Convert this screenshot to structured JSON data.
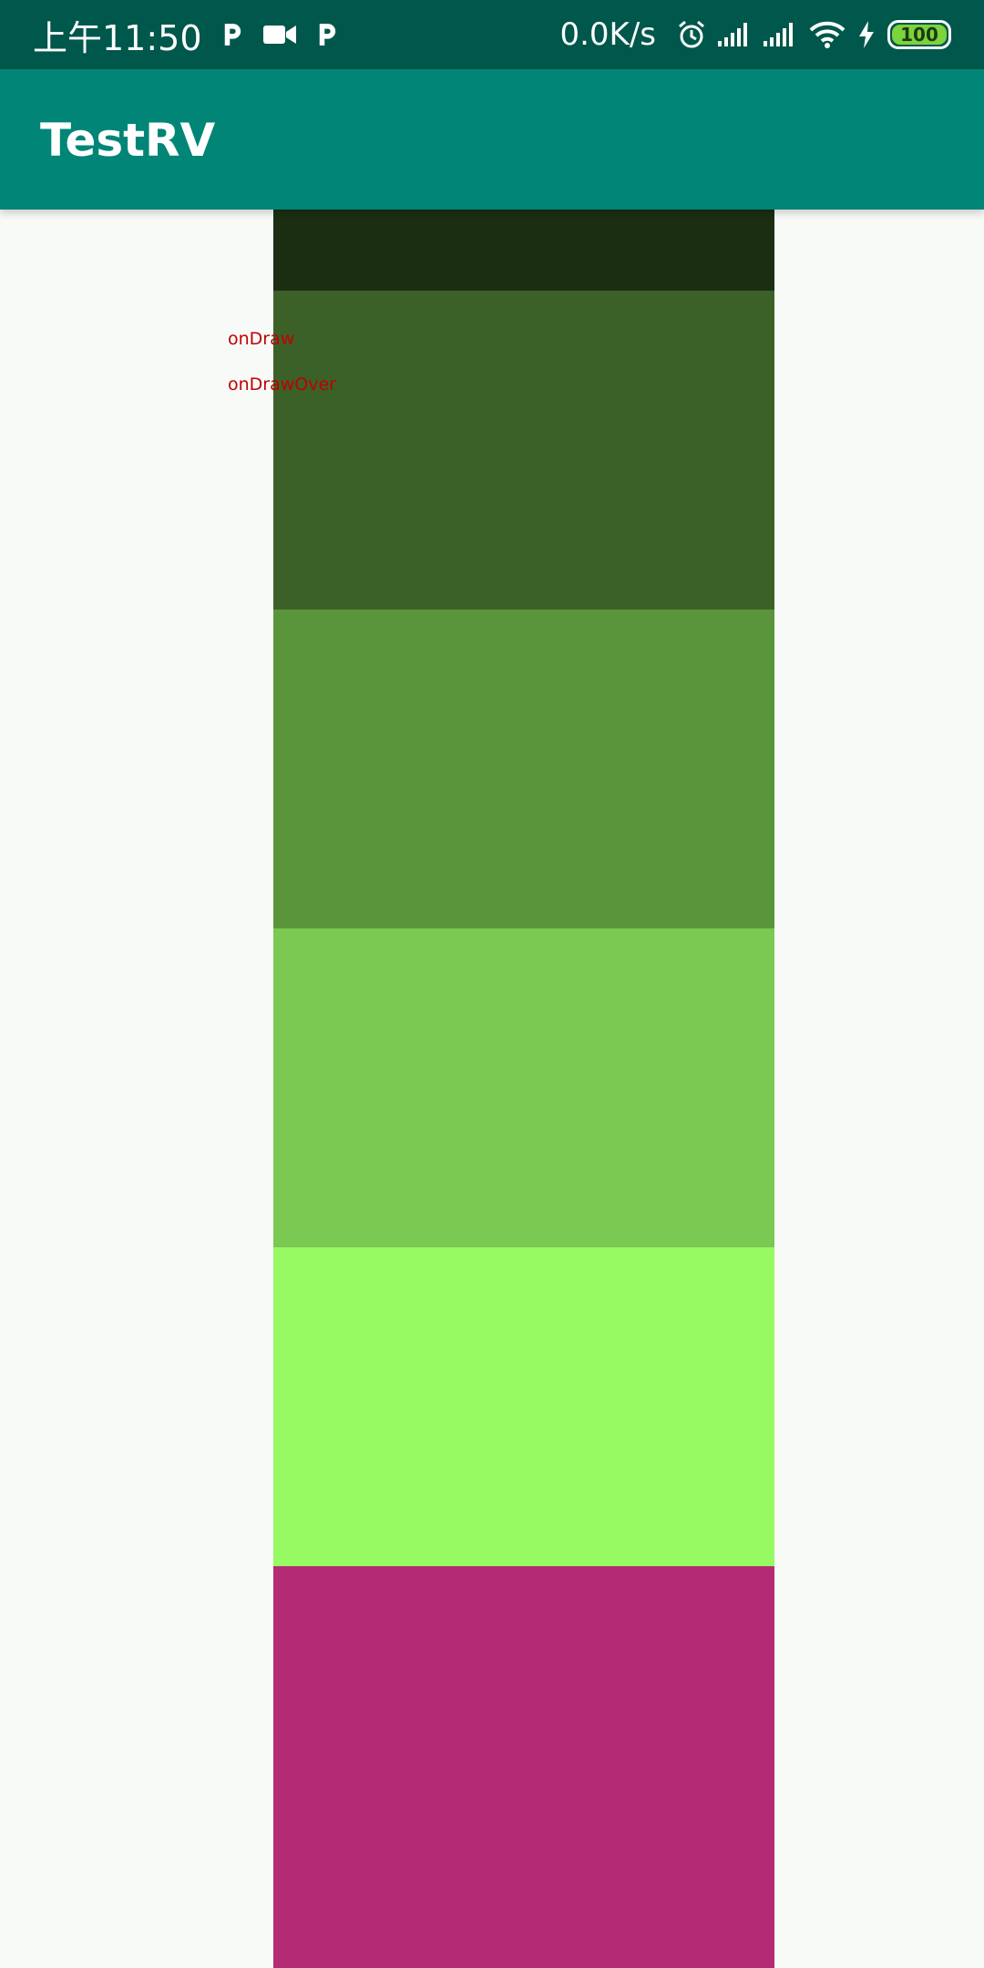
{
  "status_bar": {
    "time": "上午11:50",
    "left_icons": [
      "p-app-icon",
      "video-camera-icon",
      "p-app-icon"
    ],
    "network_speed": "0.0K/s",
    "right_icons": [
      "alarm-icon",
      "signal-icon",
      "signal-icon",
      "wifi-icon",
      "charging-icon"
    ],
    "battery": "100",
    "colors": {
      "background": "#00574b",
      "battery_fill": "#7cd33c"
    }
  },
  "app_bar": {
    "title": "TestRV",
    "background": "#008577"
  },
  "recycler": {
    "items": [
      {
        "color": "#1b2e12"
      },
      {
        "color": "#3b6129"
      },
      {
        "color": "#5b953b"
      },
      {
        "color": "#7bc853"
      },
      {
        "color": "#97fa63"
      },
      {
        "color": "#b22b74"
      }
    ],
    "debug_labels": [
      "onDraw",
      "onDrawOver"
    ]
  }
}
